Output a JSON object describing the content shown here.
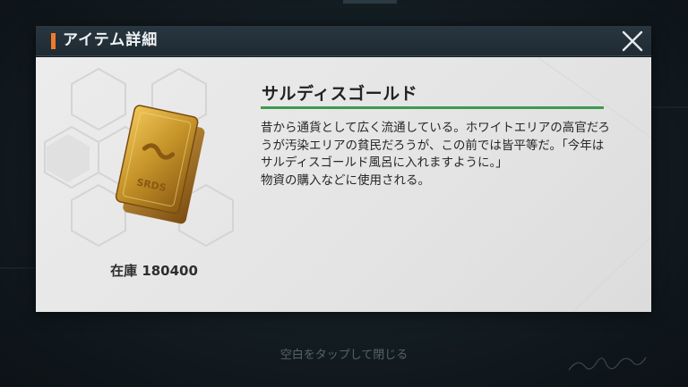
{
  "dialog": {
    "title": "アイテム詳細",
    "close_icon": "close-icon"
  },
  "item": {
    "name": "サルディスゴールド",
    "description": "昔から通貨として広く流通している。ホワイトエリアの高官だろうが汚染エリアの貧民だろうが、この前では皆平等だ。「今年はサルディスゴールド風呂に入れますように。」\n物資の購入などに使用される。",
    "stock_label": "在庫",
    "stock_value": "180400",
    "image_icon": "gold-bar-icon",
    "bar_engraving": "SRDS"
  },
  "footer": {
    "hint": "空白をタップして閉じる"
  },
  "colors": {
    "accent": "#f07a2a",
    "underline": "#3e9a52",
    "gold": "#c8962a"
  }
}
